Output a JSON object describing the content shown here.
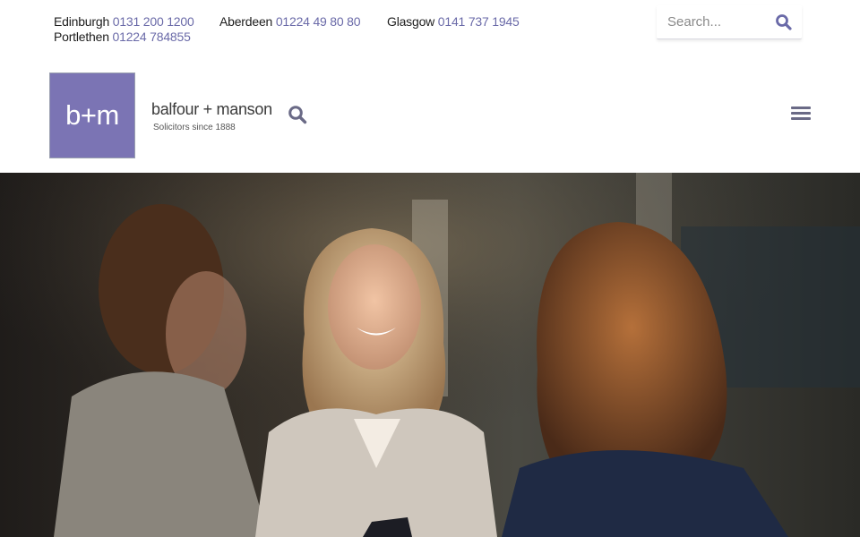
{
  "offices": [
    {
      "city": "Edinburgh",
      "phone": "0131 200 1200"
    },
    {
      "city": "Aberdeen",
      "phone": "01224 49 80 80"
    },
    {
      "city": "Glasgow",
      "phone": "0141 737 1945"
    },
    {
      "city": "Portlethen",
      "phone": "01224 784855"
    }
  ],
  "search": {
    "placeholder": "Search..."
  },
  "brand": {
    "mark": "b+m",
    "name": "balfour + manson",
    "tagline": "Solicitors since 1888"
  },
  "icons": {
    "search": "search-icon",
    "menu": "hamburger-menu-icon"
  },
  "colors": {
    "brand": "#7b74b4",
    "phone": "#6a6aa8",
    "icon": "#6a6a86"
  },
  "hero": {
    "image": "smiling-woman-in-meeting"
  }
}
